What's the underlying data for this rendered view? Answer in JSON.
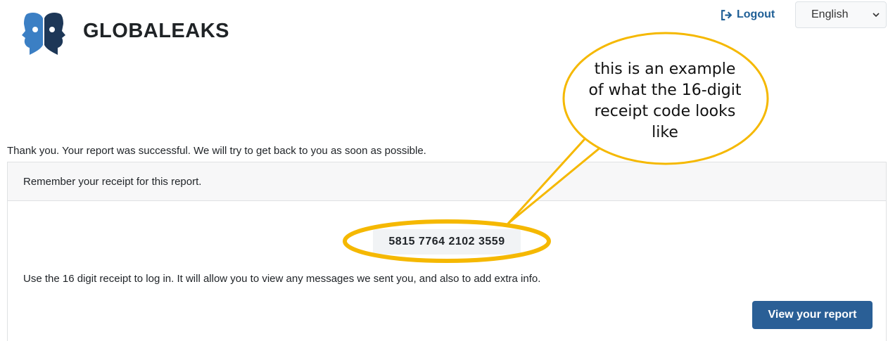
{
  "header": {
    "brand": "GLOBALEAKS",
    "logout_label": "Logout",
    "language_selected": "English"
  },
  "main": {
    "thanks_message": "Thank you. Your report was successful. We will try to get back to you as soon as possible.",
    "card_header": "Remember your receipt for this report.",
    "receipt_code": "5815 7764 2102 3559",
    "instructions": "Use the 16 digit receipt to log in. It will allow you to view any messages we sent you, and also to add extra info.",
    "view_button_label": "View your report"
  },
  "annotation": {
    "lines": [
      "this is an example",
      "of what the 16-digit",
      "receipt code looks",
      "like"
    ]
  },
  "colors": {
    "accent": "#2a5f96",
    "link": "#1f5f96",
    "callout_stroke": "#f5b800"
  },
  "icons": {
    "logo": "globaleaks-logo-icon",
    "logout": "sign-out-icon",
    "dropdown": "chevron-down-icon"
  }
}
